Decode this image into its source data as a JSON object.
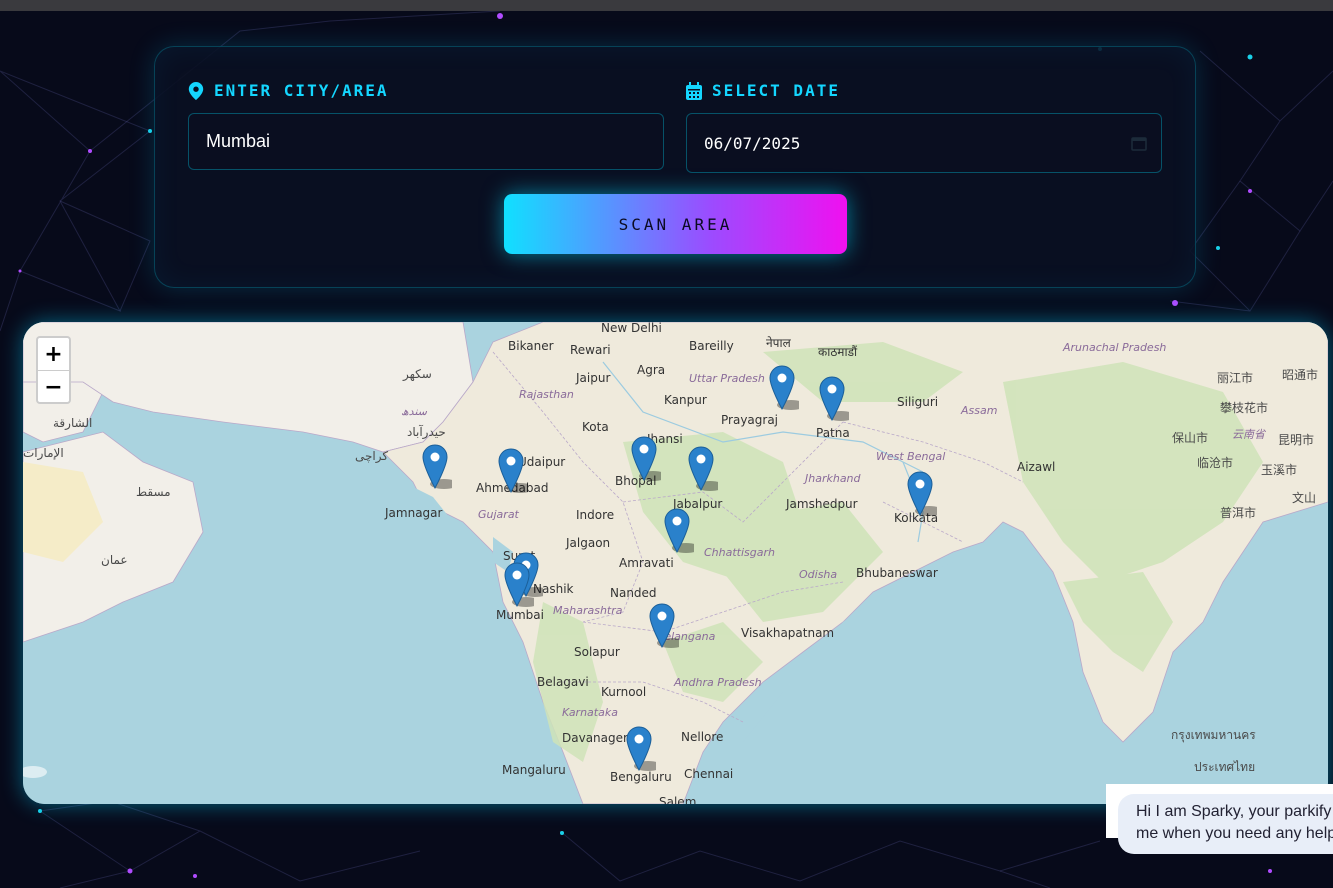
{
  "search": {
    "city_label": "ENTER CITY/AREA",
    "city_value": "Mumbai",
    "date_label": "SELECT DATE",
    "date_value": "06/07/2025",
    "scan_button": "SCAN AREA"
  },
  "map": {
    "zoom_in": "+",
    "zoom_out": "−",
    "labels": {
      "new_delhi": "New Delhi",
      "bikaner": "Bikaner",
      "rewari": "Rewari",
      "bareilly": "Bareilly",
      "nepal": "नेपाल",
      "kathmandu": "काठमाडौं",
      "jaipur": "Jaipur",
      "agra": "Agra",
      "uttar_pradesh": "Uttar Pradesh",
      "rajasthan": "Rajasthan",
      "kanpur": "Kanpur",
      "prayagraj": "Prayagraj",
      "patna": "Patna",
      "siliguri": "Siliguri",
      "assam": "Assam",
      "kota": "Kota",
      "jhansi": "Jhansi",
      "bhopal": "Bhopal",
      "udaipur": "Udaipur",
      "ahmedabad": "Ahmedabad",
      "jamnagar": "Jamnagar",
      "gujarat": "Gujarat",
      "indore": "Indore",
      "jabalpur": "Jabalpur",
      "jharkhand": "Jharkhand",
      "jamshedpur": "Jamshedpur",
      "west_bengal": "West Bengal",
      "kolkata": "Kolkata",
      "aizawl": "Aizawl",
      "surat": "Surat",
      "nashik": "Nashik",
      "jalgaon": "Jalgaon",
      "amravati": "Amravati",
      "chhattisgarh": "Chhattisgarh",
      "odisha": "Odisha",
      "bhubaneswar": "Bhubaneswar",
      "mumbai": "Mumbai",
      "maharashtra": "Maharashtra",
      "nanded": "Nanded",
      "telangana": "Telangana",
      "visakhapatnam": "Visakhapatnam",
      "solapur": "Solapur",
      "belagavi": "Belagavi",
      "kurnool": "Kurnool",
      "andhra_pradesh": "Andhra Pradesh",
      "karnataka": "Karnataka",
      "davanagere": "Davanagere",
      "nellore": "Nellore",
      "mangaluru": "Mangaluru",
      "bengaluru": "Bengaluru",
      "chennai": "Chennai",
      "salem": "Salem",
      "karachi": "کراچی",
      "sukkur": "سکھر",
      "hyderabad_pk": "حیدرآباد",
      "sindh": "سندھ",
      "arunachal": "Arunachal Pradesh",
      "lijiang": "丽江市",
      "zhaotong": "昭通市",
      "panzhihua": "攀枝花市",
      "baoshan": "保山市",
      "yunnan": "云南省",
      "kunming": "昆明市",
      "lincang": "临沧市",
      "yuxi": "玉溪市",
      "puer": "普洱市",
      "wenshan": "文山",
      "bangkok": "กรุงเทพมหานคร",
      "thailand": "ประเทศไทย",
      "oman": "عمان",
      "muscat": "مسقط",
      "uae": "الإمارات",
      "sharjah": "الشارقة"
    },
    "markers": [
      {
        "city": "Ahmedabad"
      },
      {
        "city": "Jamnagar"
      },
      {
        "city": "Bhopal"
      },
      {
        "city": "Jabalpur"
      },
      {
        "city": "Gorakhpur"
      },
      {
        "city": "Patna"
      },
      {
        "city": "Kolkata"
      },
      {
        "city": "Amravati"
      },
      {
        "city": "Nashik"
      },
      {
        "city": "Mumbai"
      },
      {
        "city": "Hyderabad"
      },
      {
        "city": "Bengaluru"
      }
    ]
  },
  "chat": {
    "message_line1": "Hi I am Sparky, your parkify",
    "message_line2": "me when you need any help"
  }
}
